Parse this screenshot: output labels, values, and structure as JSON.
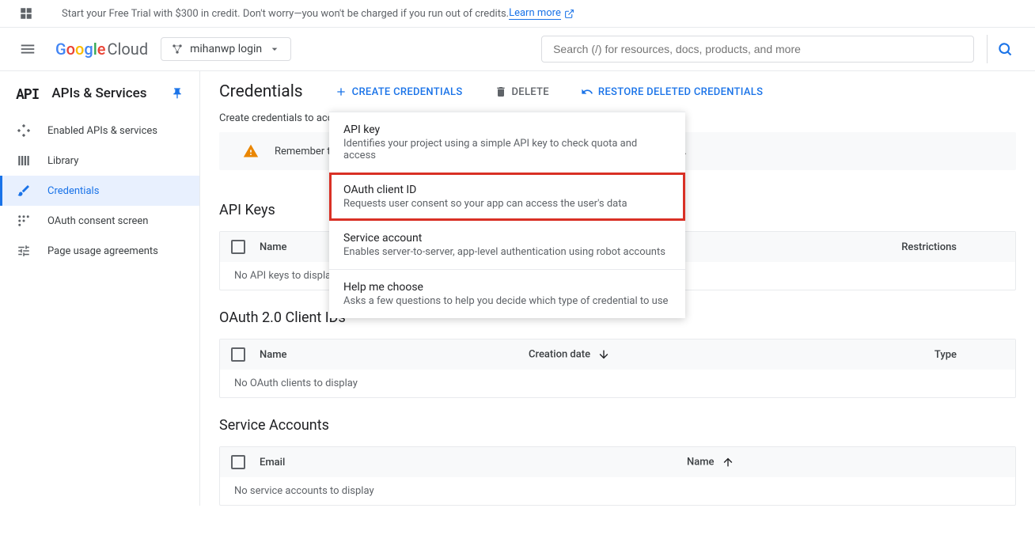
{
  "promo": {
    "text": "Start your Free Trial with $300 in credit. Don't worry—you won't be charged if you run out of credits. ",
    "link": "Learn more"
  },
  "header": {
    "logo_product": "Google",
    "logo_suffix": " Cloud",
    "project_name": "mihanwp login",
    "search_placeholder": "Search (/) for resources, docs, products, and more"
  },
  "sidebar": {
    "title": "APIs & Services",
    "items": [
      {
        "label": "Enabled APIs & services",
        "icon": "diamond-dots"
      },
      {
        "label": "Library",
        "icon": "library"
      },
      {
        "label": "Credentials",
        "icon": "key",
        "active": true
      },
      {
        "label": "OAuth consent screen",
        "icon": "consent"
      },
      {
        "label": "Page usage agreements",
        "icon": "agreements"
      }
    ]
  },
  "content": {
    "title": "Credentials",
    "actions": {
      "create": "CREATE CREDENTIALS",
      "delete": "DELETE",
      "restore": "RESTORE DELETED CREDENTIALS"
    },
    "subheading": "Create credentials to access your enabled APIs.",
    "warning": "Remember to configure the OAuth consent screen with information about your application.",
    "sections": {
      "api_keys": {
        "title": "API Keys",
        "columns": {
          "name": "Name",
          "restrictions": "Restrictions"
        },
        "empty": "No API keys to display"
      },
      "oauth_clients": {
        "title": "OAuth 2.0 Client IDs",
        "columns": {
          "name": "Name",
          "creation_date": "Creation date",
          "type": "Type"
        },
        "empty": "No OAuth clients to display"
      },
      "service_accounts": {
        "title": "Service Accounts",
        "columns": {
          "email": "Email",
          "name": "Name"
        },
        "empty": "No service accounts to display"
      }
    }
  },
  "dropdown": {
    "items": [
      {
        "title": "API key",
        "desc": "Identifies your project using a simple API key to check quota and access"
      },
      {
        "title": "OAuth client ID",
        "desc": "Requests user consent so your app can access the user's data",
        "highlighted": true
      },
      {
        "title": "Service account",
        "desc": "Enables server-to-server, app-level authentication using robot accounts"
      },
      {
        "title": "Help me choose",
        "desc": "Asks a few questions to help you decide which type of credential to use",
        "separator": true
      }
    ]
  }
}
